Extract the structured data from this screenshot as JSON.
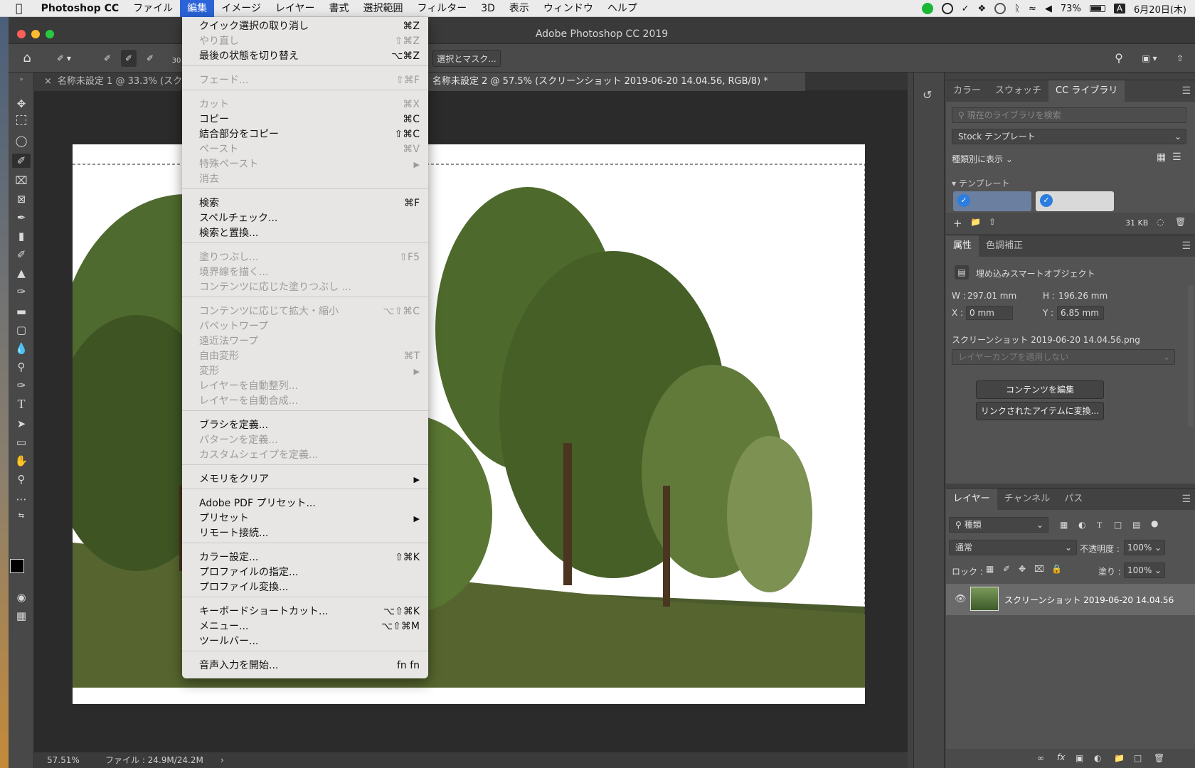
{
  "menubar": {
    "app": "Photoshop CC",
    "items": [
      "ファイル",
      "編集",
      "イメージ",
      "レイヤー",
      "書式",
      "選択範囲",
      "フィルター",
      "3D",
      "表示",
      "ウィンドウ",
      "ヘルプ"
    ],
    "battery": "73%",
    "input_mode": "A",
    "date": "6月20日(木)"
  },
  "window": {
    "title": "Adobe Photoshop CC 2019"
  },
  "options_bar": {
    "size_value": "30",
    "select_and_mask": "選択とマスク..."
  },
  "tabs": [
    {
      "label": "名称未設定 1 @ 33.3% (スク"
    },
    {
      "label": "名称未設定 2 @ 57.5% (スクリーンショット 2019-06-20 14.04.56, RGB/8) *"
    }
  ],
  "status": {
    "zoom": "57.51%",
    "file": "ファイル : 24.9M/24.2M"
  },
  "edit_menu": {
    "items": [
      {
        "label": "クイック選択の取り消し",
        "shortcut": "⌘Z",
        "disabled": false
      },
      {
        "label": "やり直し",
        "shortcut": "⇧⌘Z",
        "disabled": true
      },
      {
        "label": "最後の状態を切り替え",
        "shortcut": "⌥⌘Z",
        "disabled": false
      },
      {
        "label": "フェード...",
        "shortcut": "⇧⌘F",
        "disabled": true
      },
      {
        "label": "カット",
        "shortcut": "⌘X",
        "disabled": true
      },
      {
        "label": "コピー",
        "shortcut": "⌘C",
        "disabled": false
      },
      {
        "label": "結合部分をコピー",
        "shortcut": "⇧⌘C",
        "disabled": false
      },
      {
        "label": "ペースト",
        "shortcut": "⌘V",
        "disabled": true
      },
      {
        "label": "特殊ペースト",
        "shortcut": "",
        "disabled": true
      },
      {
        "label": "消去",
        "shortcut": "",
        "disabled": true
      },
      {
        "label": "検索",
        "shortcut": "⌘F",
        "disabled": false
      },
      {
        "label": "スペルチェック...",
        "shortcut": "",
        "disabled": false
      },
      {
        "label": "検索と置換...",
        "shortcut": "",
        "disabled": false
      },
      {
        "label": "塗りつぶし...",
        "shortcut": "⇧F5",
        "disabled": true
      },
      {
        "label": "境界線を描く...",
        "shortcut": "",
        "disabled": true
      },
      {
        "label": "コンテンツに応じた塗りつぶし ...",
        "shortcut": "",
        "disabled": true
      },
      {
        "label": "コンテンツに応じて拡大・縮小",
        "shortcut": "⌥⇧⌘C",
        "disabled": true
      },
      {
        "label": "パペットワープ",
        "shortcut": "",
        "disabled": true
      },
      {
        "label": "遠近法ワープ",
        "shortcut": "",
        "disabled": true
      },
      {
        "label": "自由変形",
        "shortcut": "⌘T",
        "disabled": true
      },
      {
        "label": "変形",
        "shortcut": "",
        "disabled": true
      },
      {
        "label": "レイヤーを自動整列...",
        "shortcut": "",
        "disabled": true
      },
      {
        "label": "レイヤーを自動合成...",
        "shortcut": "",
        "disabled": true
      },
      {
        "label": "ブラシを定義...",
        "shortcut": "",
        "disabled": false
      },
      {
        "label": "パターンを定義...",
        "shortcut": "",
        "disabled": true
      },
      {
        "label": "カスタムシェイプを定義...",
        "shortcut": "",
        "disabled": true
      },
      {
        "label": "メモリをクリア",
        "shortcut": "",
        "disabled": false
      },
      {
        "label": "Adobe PDF プリセット...",
        "shortcut": "",
        "disabled": false
      },
      {
        "label": "プリセット",
        "shortcut": "",
        "disabled": false
      },
      {
        "label": "リモート接続...",
        "shortcut": "",
        "disabled": false
      },
      {
        "label": "カラー設定...",
        "shortcut": "⇧⌘K",
        "disabled": false
      },
      {
        "label": "プロファイルの指定...",
        "shortcut": "",
        "disabled": false
      },
      {
        "label": "プロファイル変換...",
        "shortcut": "",
        "disabled": false
      },
      {
        "label": "キーボードショートカット...",
        "shortcut": "⌥⇧⌘K",
        "disabled": false
      },
      {
        "label": "メニュー...",
        "shortcut": "⌥⇧⌘M",
        "disabled": false
      },
      {
        "label": "ツールバー...",
        "shortcut": "",
        "disabled": false
      },
      {
        "label": "音声入力を開始...",
        "shortcut": "fn fn",
        "disabled": false
      }
    ]
  },
  "library_panel": {
    "tabs": [
      "カラー",
      "スウォッチ",
      "CC ライブラリ"
    ],
    "search_placeholder": "現在のライブラリを検索",
    "library_select": "Stock テンプレート",
    "view_by": "種類別に表示",
    "section": "テンプレート",
    "size": "31 KB"
  },
  "properties_panel": {
    "tabs": [
      "属性",
      "色調補正"
    ],
    "type": "埋め込みスマートオブジェクト",
    "w_label": "W :",
    "w": "297.01 mm",
    "h_label": "H :",
    "h": "196.26 mm",
    "x_label": "X :",
    "x": "0 mm",
    "y_label": "Y :",
    "y": "6.85 mm",
    "filename": "スクリーンショット 2019-06-20 14.04.56.png",
    "comp_placeholder": "レイヤーカンプを適用しない",
    "edit_btn": "コンテンツを編集",
    "convert_btn": "リンクされたアイテムに変換..."
  },
  "layers_panel": {
    "tabs": [
      "レイヤー",
      "チャンネル",
      "パス"
    ],
    "filter": "種類",
    "blend": "通常",
    "opacity_label": "不透明度 :",
    "opacity": "100%",
    "lock_label": "ロック :",
    "fill_label": "塗り :",
    "fill": "100%",
    "layer_name": "スクリーンショット 2019-06-20 14.04.56"
  }
}
